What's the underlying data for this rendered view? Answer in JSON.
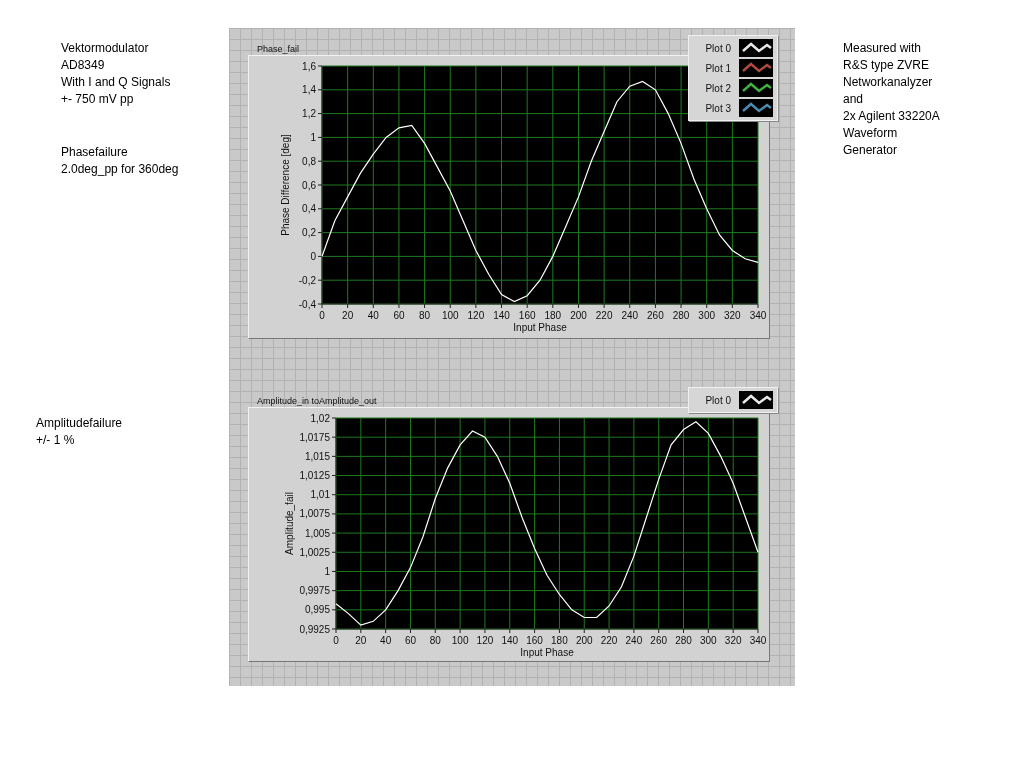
{
  "left_notes": [
    {
      "lines": [
        "Vektormodulator",
        "AD8349",
        "With I and Q Signals",
        "+- 750 mV pp"
      ]
    },
    {
      "lines": [
        "Phasefailure",
        "2.0deg_pp for 360deg"
      ]
    },
    {
      "lines": [
        "Amplitudefailure",
        "+/- 1 %"
      ]
    }
  ],
  "charts": [
    {
      "title": "Phase_fail",
      "legend": [
        {
          "label": "Plot 0",
          "color": "#e8e8e8"
        },
        {
          "label": "Plot 1",
          "color": "#b04a40"
        },
        {
          "label": "Plot 2",
          "color": "#40b040"
        },
        {
          "label": "Plot 3",
          "color": "#4a8ab0"
        }
      ],
      "chart_data": {
        "type": "line",
        "grid": true,
        "xlabel": "Input Phase",
        "ylabel": "Phase Difference [deg]",
        "x": [
          0,
          10,
          20,
          30,
          40,
          50,
          60,
          70,
          80,
          90,
          100,
          110,
          120,
          130,
          140,
          150,
          160,
          170,
          180,
          190,
          200,
          210,
          220,
          230,
          240,
          250,
          260,
          270,
          280,
          290,
          300,
          310,
          320,
          330,
          340
        ],
        "series": [
          {
            "color": "#ffffff",
            "values": [
              0.0,
              0.3,
              0.5,
              0.7,
              0.86,
              1.0,
              1.08,
              1.1,
              0.95,
              0.75,
              0.55,
              0.3,
              0.05,
              -0.15,
              -0.32,
              -0.38,
              -0.33,
              -0.2,
              0.0,
              0.25,
              0.5,
              0.8,
              1.05,
              1.3,
              1.43,
              1.47,
              1.4,
              1.2,
              0.95,
              0.65,
              0.4,
              0.18,
              0.05,
              -0.02,
              -0.05
            ]
          }
        ],
        "xlim": [
          0,
          340
        ],
        "ylim": [
          -0.4,
          1.6
        ],
        "xticks": [
          0,
          20,
          40,
          60,
          80,
          100,
          120,
          140,
          160,
          180,
          200,
          220,
          240,
          260,
          280,
          300,
          320,
          340
        ],
        "yticks": [
          {
            "value": -0.4,
            "label": "-0,4"
          },
          {
            "value": -0.2,
            "label": "-0,2"
          },
          {
            "value": 0,
            "label": "0"
          },
          {
            "value": 0.2,
            "label": "0,2"
          },
          {
            "value": 0.4,
            "label": "0,4"
          },
          {
            "value": 0.6,
            "label": "0,6"
          },
          {
            "value": 0.8,
            "label": "0,8"
          },
          {
            "value": 1,
            "label": "1"
          },
          {
            "value": 1.2,
            "label": "1,2"
          },
          {
            "value": 1.4,
            "label": "1,4"
          },
          {
            "value": 1.6,
            "label": "1,6"
          }
        ]
      }
    },
    {
      "title": "Amplitude_in toAmplitude_out",
      "legend": [
        {
          "label": "Plot 0",
          "color": "#e8e8e8"
        }
      ],
      "chart_data": {
        "type": "line",
        "grid": true,
        "xlabel": "Input Phase",
        "ylabel": "Amplitude_fail",
        "x": [
          0,
          10,
          20,
          30,
          40,
          50,
          60,
          70,
          80,
          90,
          100,
          110,
          120,
          130,
          140,
          150,
          160,
          170,
          180,
          190,
          200,
          210,
          220,
          230,
          240,
          250,
          260,
          270,
          280,
          290,
          300,
          310,
          320,
          330,
          340
        ],
        "series": [
          {
            "color": "#ffffff",
            "values": [
              0.9958,
              0.9945,
              0.993,
              0.9935,
              0.995,
              0.9975,
              1.0005,
              1.0045,
              1.0095,
              1.0135,
              1.0165,
              1.0183,
              1.0175,
              1.015,
              1.0115,
              1.007,
              1.003,
              0.9995,
              0.997,
              0.995,
              0.994,
              0.994,
              0.9955,
              0.998,
              1.002,
              1.007,
              1.012,
              1.0165,
              1.0185,
              1.0195,
              1.018,
              1.015,
              1.0115,
              1.007,
              1.0025
            ]
          }
        ],
        "xlim": [
          0,
          340
        ],
        "ylim": [
          0.9925,
          1.02
        ],
        "xticks": [
          0,
          20,
          40,
          60,
          80,
          100,
          120,
          140,
          160,
          180,
          200,
          220,
          240,
          260,
          280,
          300,
          320,
          340
        ],
        "yticks": [
          {
            "value": 0.9925,
            "label": "0,9925"
          },
          {
            "value": 0.995,
            "label": "0,995"
          },
          {
            "value": 0.9975,
            "label": "0,9975"
          },
          {
            "value": 1,
            "label": "1"
          },
          {
            "value": 1.0025,
            "label": "1,0025"
          },
          {
            "value": 1.005,
            "label": "1,005"
          },
          {
            "value": 1.0075,
            "label": "1,0075"
          },
          {
            "value": 1.01,
            "label": "1,01"
          },
          {
            "value": 1.0125,
            "label": "1,0125"
          },
          {
            "value": 1.015,
            "label": "1,015"
          },
          {
            "value": 1.0175,
            "label": "1,0175"
          },
          {
            "value": 1.02,
            "label": "1,02"
          }
        ]
      }
    }
  ],
  "right_notes": [
    {
      "lines": [
        "Measured with",
        "R&S type ZVRE",
        "Networkanalyzer",
        "and",
        "2x Agilent 33220A",
        "Waveform",
        "Generator"
      ]
    }
  ]
}
